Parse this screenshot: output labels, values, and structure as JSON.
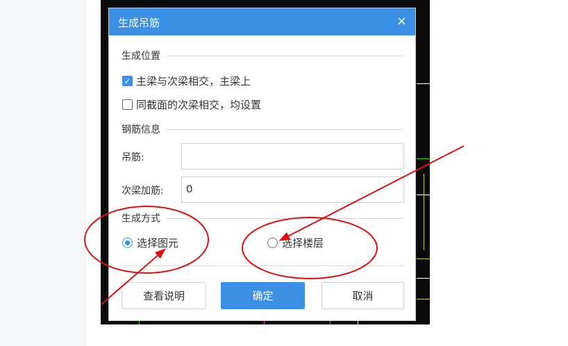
{
  "dialog": {
    "title": "生成吊筋",
    "close_glyph": "×",
    "sections": {
      "position": "生成位置",
      "rebar_info": "钢筋信息",
      "method": "生成方式"
    },
    "checkboxes": [
      {
        "label": "主梁与次梁相交，主梁上",
        "checked": true
      },
      {
        "label": "同截面的次梁相交，均设置",
        "checked": false
      }
    ],
    "fields": {
      "hanger_label": "吊筋:",
      "hanger_value": "",
      "secondary_label": "次梁加筋:",
      "secondary_value": "0"
    },
    "radios": [
      {
        "label": "选择图元",
        "selected": true
      },
      {
        "label": "选择楼层",
        "selected": false
      }
    ],
    "buttons": {
      "help": "查看说明",
      "ok": "确定",
      "cancel": "取消"
    }
  },
  "colors": {
    "accent": "#3b8fe5",
    "annotation": "#e01010",
    "cad_background": "#0b0b0b"
  }
}
